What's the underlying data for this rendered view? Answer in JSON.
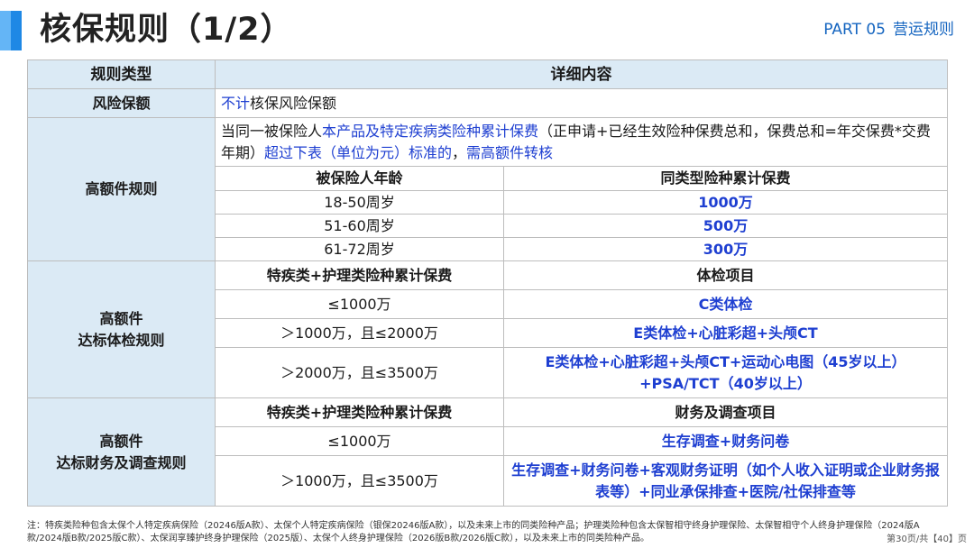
{
  "header": {
    "title": "核保规则（1/2）",
    "part_no": "PART 05",
    "part_name": "营运规则"
  },
  "table": {
    "col_headers": [
      "规则类型",
      "详细内容"
    ],
    "risk": {
      "category": "风险保额",
      "highlight": "不计",
      "text": "核保风险保额"
    },
    "high_amount": {
      "category": "高额件规则",
      "desc_1": "当同一被保险人",
      "desc_2": "本产品及特定疾病类险种累计保费",
      "desc_3": "（正申请+已经生效险种保费总和，保费总和=年交保费*交费年期）",
      "desc_4": "超过下表（单位为元）标准的",
      "desc_5": "，",
      "desc_6": "需高额件转核",
      "sub_headers": [
        "被保险人年龄",
        "同类型险种累计保费"
      ],
      "rows": [
        {
          "age": "18-50周岁",
          "premium": "1000万"
        },
        {
          "age": "51-60周岁",
          "premium": "500万"
        },
        {
          "age": "61-72周岁",
          "premium": "300万"
        }
      ]
    },
    "medical": {
      "category_line1": "高额件",
      "category_line2": "达标体检规则",
      "sub_headers": [
        "特疾类+护理类险种累计保费",
        "体检项目"
      ],
      "rows": [
        {
          "range": "≤1000万",
          "item": "C类体检"
        },
        {
          "range": "＞1000万，且≤2000万",
          "item": "E类体检+心脏彩超+头颅CT"
        },
        {
          "range": "＞2000万，且≤3500万",
          "item": "E类体检+心脏彩超+头颅CT+运动心电图（45岁以上）+PSA/TCT（40岁以上）"
        }
      ]
    },
    "finance": {
      "category_line1": "高额件",
      "category_line2": "达标财务及调查规则",
      "sub_headers": [
        "特疾类+护理类险种累计保费",
        "财务及调查项目"
      ],
      "rows": [
        {
          "range": "≤1000万",
          "item": "生存调查+财务问卷"
        },
        {
          "range": "＞1000万，且≤3500万",
          "item": "生存调查+财务问卷+客观财务证明（如个人收入证明或企业财务报表等）+同业承保排查+医院/社保排查等"
        }
      ]
    }
  },
  "footnote": "注：特疾类险种包含太保个人特定疾病保险（20246版A款）、太保个人特定疾病保险（银保20246版A款），以及未来上市的同类险种产品；护理类险种包含太保智相守终身护理保险、太保智相守个人终身护理保险（2024版A款/2024版B款/2025版C款）、太保润享臻护终身护理保险（2025版）、太保个人终身护理保险（2026版B款/2026版C款），以及未来上市的同类险种产品。",
  "page_indicator": "第30页/共【40】页",
  "colors": {
    "accent": "#1e88e5",
    "header_bg": "#dbeaf5",
    "highlight_text": "#1e3fd1",
    "part_label": "#1565c0"
  }
}
